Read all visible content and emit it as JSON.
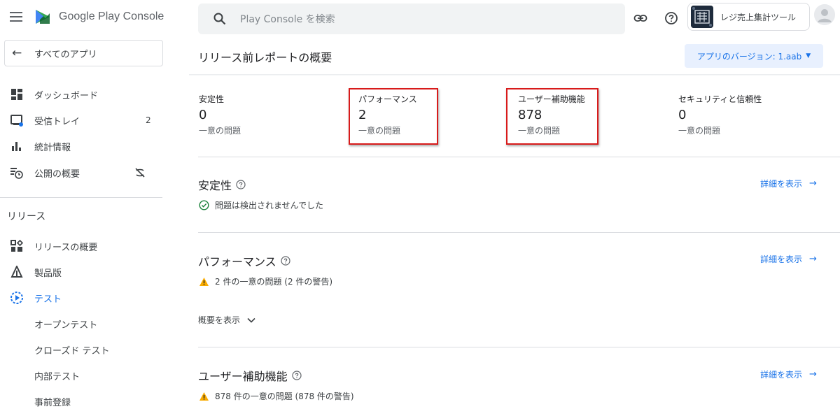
{
  "brand": {
    "name": "Google Play",
    "product": "Console"
  },
  "back": {
    "label": "すべてのアプリ"
  },
  "nav": {
    "dashboard": "ダッシュボード",
    "inbox": "受信トレイ",
    "inbox_count": "2",
    "stats": "統計情報",
    "publishing_overview": "公開の概要",
    "section_release": "リリース",
    "release_overview": "リリースの概要",
    "production": "製品版",
    "testing": "テスト",
    "open_testing": "オープンテスト",
    "closed_testing": "クローズド テスト",
    "internal_testing": "内部テスト",
    "preregistration": "事前登録"
  },
  "search": {
    "placeholder": "Play Console を検索"
  },
  "app": {
    "name": "レジ売上集計ツール"
  },
  "page": {
    "title": "リリース前レポートの概要",
    "version_label": "アプリのバージョン: 1.aab"
  },
  "metrics": [
    {
      "label": "安定性",
      "value": "0",
      "sub": "一意の問題"
    },
    {
      "label": "パフォーマンス",
      "value": "2",
      "sub": "一意の問題"
    },
    {
      "label": "ユーザー補助機能",
      "value": "878",
      "sub": "一意の問題"
    },
    {
      "label": "セキュリティと信頼性",
      "value": "0",
      "sub": "一意の問題"
    }
  ],
  "sections": {
    "stability": {
      "title": "安定性",
      "status": "問題は検出されませんでした",
      "link": "詳細を表示"
    },
    "performance": {
      "title": "パフォーマンス",
      "status": "2 件の一意の問題 (2 件の警告)",
      "link": "詳細を表示",
      "expand": "概要を表示"
    },
    "accessibility": {
      "title": "ユーザー補助機能",
      "status": "878 件の一意の問題 (878 件の警告)",
      "link": "詳細を表示"
    }
  },
  "colors": {
    "accent": "#1a73e8",
    "warning": "#f9ab00",
    "success": "#188038",
    "highlight": "#d81b1b"
  }
}
